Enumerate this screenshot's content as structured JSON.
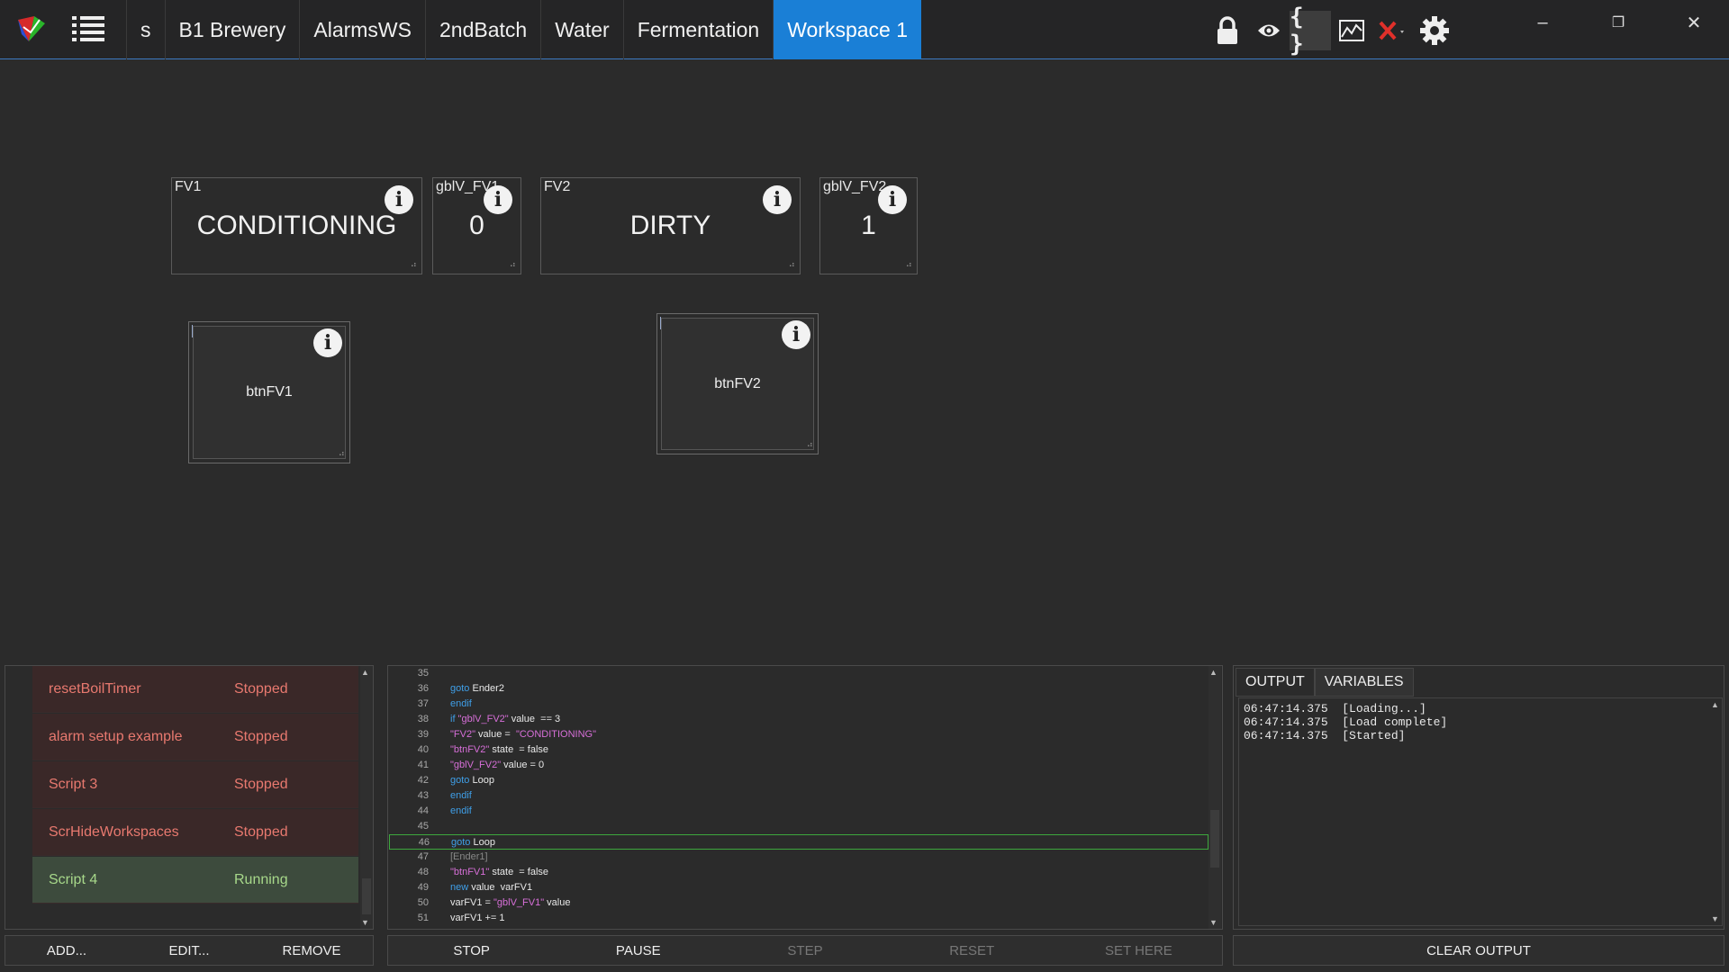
{
  "tabs": [
    {
      "label": "s",
      "active": false
    },
    {
      "label": "B1 Brewery",
      "active": false
    },
    {
      "label": "AlarmsWS",
      "active": false
    },
    {
      "label": "2ndBatch",
      "active": false
    },
    {
      "label": "Water",
      "active": false
    },
    {
      "label": "Fermentation",
      "active": false
    },
    {
      "label": "Workspace 1",
      "active": true
    }
  ],
  "toolbar_icons": [
    "lock-icon",
    "eye-icon",
    "braces-icon",
    "chart-icon",
    "close-x-icon",
    "gear-icon"
  ],
  "window_controls": {
    "minimize": "–",
    "restore": "❐",
    "close": "✕"
  },
  "widgets": {
    "fv1": {
      "title": "FV1",
      "value": "CONDITIONING"
    },
    "gblv_fv1": {
      "title": "gblV_FV1",
      "value": "0"
    },
    "fv2": {
      "title": "FV2",
      "value": "DIRTY"
    },
    "gblv_fv2": {
      "title": "gblV_FV2",
      "value": "1"
    },
    "btn_fv1": {
      "label": "btnFV1"
    },
    "btn_fv2": {
      "label": "btnFV2"
    }
  },
  "scripts": [
    {
      "name": "resetBoilTimer",
      "status": "Stopped"
    },
    {
      "name": "alarm setup example",
      "status": "Stopped"
    },
    {
      "name": "Script 3",
      "status": "Stopped"
    },
    {
      "name": "ScrHideWorkspaces",
      "status": "Stopped"
    },
    {
      "name": "Script 4",
      "status": "Running"
    }
  ],
  "script_buttons": {
    "add": "ADD...",
    "edit": "EDIT...",
    "remove": "REMOVE"
  },
  "code_lines": [
    {
      "n": "35",
      "html": ""
    },
    {
      "n": "36",
      "html": "<span class='kw'>goto</span> Ender2"
    },
    {
      "n": "37",
      "html": "<span class='kw'>endif</span>"
    },
    {
      "n": "38",
      "html": "<span class='kw'>if</span> <span class='str'>\"gblV_FV2\"</span> value  == 3"
    },
    {
      "n": "39",
      "html": "<span class='str'>\"FV2\"</span> value =  <span class='str'>\"CONDITIONING\"</span>"
    },
    {
      "n": "40",
      "html": "<span class='str'>\"btnFV2\"</span> state  = false"
    },
    {
      "n": "41",
      "html": "<span class='str'>\"gblV_FV2\"</span> value = 0"
    },
    {
      "n": "42",
      "html": "<span class='kw'>goto</span> Loop"
    },
    {
      "n": "43",
      "html": "<span class='kw'>endif</span>"
    },
    {
      "n": "44",
      "html": "<span class='kw'>endif</span>"
    },
    {
      "n": "45",
      "html": ""
    },
    {
      "n": "46",
      "html": "<span class='kw'>goto</span> Loop"
    },
    {
      "n": "47",
      "html": "<span class='cm'>[Ender1]</span>"
    },
    {
      "n": "48",
      "html": "<span class='str'>\"btnFV1\"</span> state  = false"
    },
    {
      "n": "49",
      "html": "<span class='kw'>new</span> value  varFV1"
    },
    {
      "n": "50",
      "html": "varFV1 = <span class='str'>\"gblV_FV1\"</span> value"
    },
    {
      "n": "51",
      "html": "varFV1 += 1"
    }
  ],
  "current_line": "46",
  "editor_buttons": {
    "stop": "STOP",
    "pause": "PAUSE",
    "step": "STEP",
    "reset": "RESET",
    "set_here": "SET HERE"
  },
  "output_tabs": {
    "output": "OUTPUT",
    "variables": "VARIABLES"
  },
  "output_lines": [
    "06:47:14.375  [Loading...]",
    "06:47:14.375  [Load complete]",
    "06:47:14.375  [Started]"
  ],
  "clear_output": "CLEAR OUTPUT",
  "colors": {
    "accent": "#1a7fd6",
    "stopped": "#e8796f",
    "running": "#a7d88a",
    "keyword": "#3f9fe8",
    "string": "#d76fd8"
  }
}
